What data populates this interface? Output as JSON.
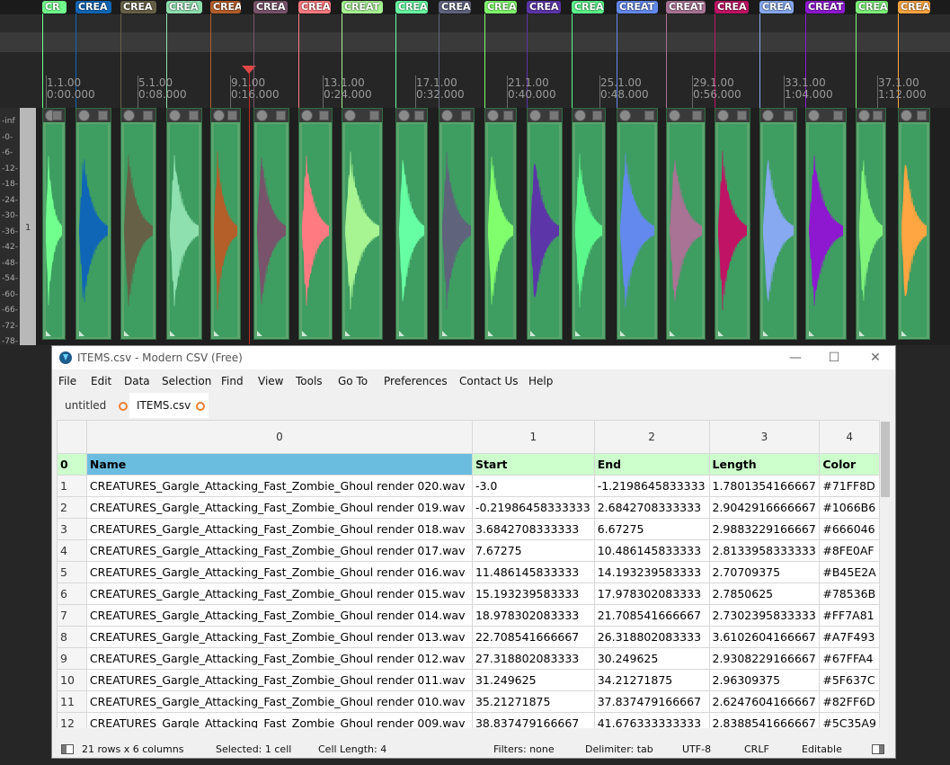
{
  "daw": {
    "regions": [
      {
        "label": "CR",
        "color": "#71FF8D"
      },
      {
        "label": "CREA",
        "color": "#1066B6"
      },
      {
        "label": "CREA",
        "color": "#666046"
      },
      {
        "label": "CREA",
        "color": "#8FE0AF"
      },
      {
        "label": "CREA",
        "color": "#B45E2A"
      },
      {
        "label": "CREA",
        "color": "#78536B"
      },
      {
        "label": "CREA",
        "color": "#FF7A81"
      },
      {
        "label": "CREAT",
        "color": "#A7F493"
      },
      {
        "label": "CREA",
        "color": "#67FFA4"
      },
      {
        "label": "CREA",
        "color": "#5F637C"
      },
      {
        "label": "CREA",
        "color": "#82FF6D"
      },
      {
        "label": "CREA",
        "color": "#5C35A9"
      },
      {
        "label": "CREA",
        "color": "#5BF88B"
      },
      {
        "label": "CREAT",
        "color": "#6389EE"
      },
      {
        "label": "CREAT",
        "color": "#A87394"
      },
      {
        "label": "CREA",
        "color": "#C01365"
      },
      {
        "label": "CREA",
        "color": "#86A9F1"
      },
      {
        "label": "CREAT",
        "color": "#8D18D0"
      },
      {
        "label": "CREA",
        "color": "#7EF47A"
      },
      {
        "label": "CREA",
        "color": "#FFA541"
      }
    ],
    "ruler": [
      {
        "bar": "1.1.00",
        "time": "0:00.000"
      },
      {
        "bar": "5.1.00",
        "time": "0:08.000"
      },
      {
        "bar": "9.1.00",
        "time": "0:16.000"
      },
      {
        "bar": "13.1.00",
        "time": "0:24.000"
      },
      {
        "bar": "17.1.00",
        "time": "0:32.000"
      },
      {
        "bar": "21.1.00",
        "time": "0:40.000"
      },
      {
        "bar": "25.1.00",
        "time": "0:48.000"
      },
      {
        "bar": "29.1.00",
        "time": "0:56.000"
      },
      {
        "bar": "33.1.00",
        "time": "1:04.000"
      },
      {
        "bar": "37.1.00",
        "time": "1:12.000"
      }
    ],
    "meter_labels": [
      "-inf",
      "-0-",
      "-6-",
      "-12-",
      "-18-",
      "-24-",
      "-30-",
      "-36-",
      "-42-",
      "-48-",
      "-54-",
      "-60-",
      "-66-",
      "-72-",
      "-78-"
    ],
    "track_number": "1"
  },
  "window": {
    "title": "ITEMS.csv - Modern CSV (Free)",
    "minimize": "—",
    "maximize": "☐",
    "close": "✕"
  },
  "menu": [
    "File",
    "Edit",
    "Data",
    "Selection",
    "Find",
    "View",
    "Tools",
    "Go To",
    "Preferences",
    "Contact Us",
    "Help"
  ],
  "tabs": [
    {
      "label": "untitled",
      "active": false
    },
    {
      "label": "ITEMS.csv",
      "active": true
    }
  ],
  "grid": {
    "column_headers": [
      "0",
      "1",
      "2",
      "3",
      "4"
    ],
    "rows": [
      [
        "0",
        "Name",
        "Start",
        "End",
        "Length",
        "Color"
      ],
      [
        "1",
        "CREATURES_Gargle_Attacking_Fast_Zombie_Ghoul render 020.wav",
        "-3.0",
        "-1.2198645833333",
        "1.7801354166667",
        "#71FF8D"
      ],
      [
        "2",
        "CREATURES_Gargle_Attacking_Fast_Zombie_Ghoul render 019.wav",
        "-0.21986458333333",
        "2.6842708333333",
        "2.9042916666667",
        "#1066B6"
      ],
      [
        "3",
        "CREATURES_Gargle_Attacking_Fast_Zombie_Ghoul render 018.wav",
        "3.6842708333333",
        "6.67275",
        "2.9883229166667",
        "#666046"
      ],
      [
        "4",
        "CREATURES_Gargle_Attacking_Fast_Zombie_Ghoul render 017.wav",
        "7.67275",
        "10.486145833333",
        "2.8133958333333",
        "#8FE0AF"
      ],
      [
        "5",
        "CREATURES_Gargle_Attacking_Fast_Zombie_Ghoul render 016.wav",
        "11.486145833333",
        "14.193239583333",
        "2.70709375",
        "#B45E2A"
      ],
      [
        "6",
        "CREATURES_Gargle_Attacking_Fast_Zombie_Ghoul render 015.wav",
        "15.193239583333",
        "17.978302083333",
        "2.7850625",
        "#78536B"
      ],
      [
        "7",
        "CREATURES_Gargle_Attacking_Fast_Zombie_Ghoul render 014.wav",
        "18.978302083333",
        "21.708541666667",
        "2.7302395833333",
        "#FF7A81"
      ],
      [
        "8",
        "CREATURES_Gargle_Attacking_Fast_Zombie_Ghoul render 013.wav",
        "22.708541666667",
        "26.318802083333",
        "3.6102604166667",
        "#A7F493"
      ],
      [
        "9",
        "CREATURES_Gargle_Attacking_Fast_Zombie_Ghoul render 012.wav",
        "27.318802083333",
        "30.249625",
        "2.9308229166667",
        "#67FFA4"
      ],
      [
        "10",
        "CREATURES_Gargle_Attacking_Fast_Zombie_Ghoul render 011.wav",
        "31.249625",
        "34.21271875",
        "2.96309375",
        "#5F637C"
      ],
      [
        "11",
        "CREATURES_Gargle_Attacking_Fast_Zombie_Ghoul render 010.wav",
        "35.21271875",
        "37.837479166667",
        "2.6247604166667",
        "#82FF6D"
      ],
      [
        "12",
        "CREATURES_Gargle_Attacking_Fast_Zombie_Ghoul render 009.wav",
        "38.837479166667",
        "41.676333333333",
        "2.8388541666667",
        "#5C35A9"
      ]
    ]
  },
  "status": {
    "dims": "21 rows x 6 columns",
    "selected": "Selected: 1 cell",
    "cell_length": "Cell Length: 4",
    "filters": "Filters: none",
    "delimiter": "Delimiter: tab",
    "encoding": "UTF-8",
    "line_ending": "CRLF",
    "mode": "Editable"
  }
}
